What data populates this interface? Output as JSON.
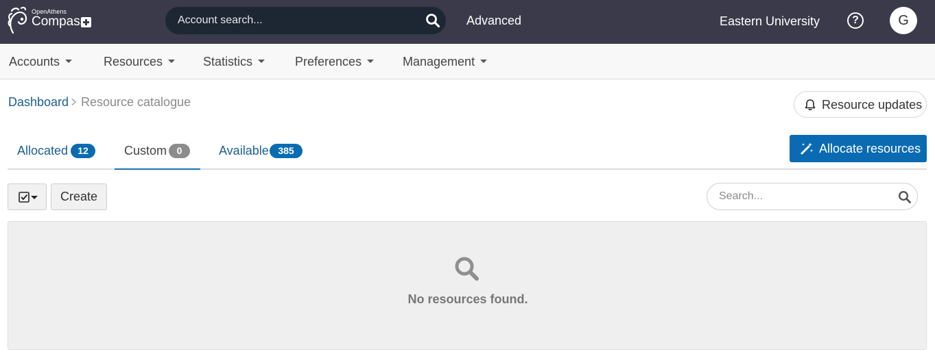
{
  "brand": {
    "small": "OpenAthens",
    "name": "Compass"
  },
  "header": {
    "search_placeholder": "Account search...",
    "advanced_label": "Advanced",
    "organisation": "Eastern University",
    "help_label": "?",
    "avatar_initial": "G"
  },
  "nav": {
    "items": [
      {
        "label": "Accounts"
      },
      {
        "label": "Resources"
      },
      {
        "label": "Statistics"
      },
      {
        "label": "Preferences"
      },
      {
        "label": "Management"
      }
    ]
  },
  "breadcrumb": {
    "root": "Dashboard",
    "current": "Resource catalogue"
  },
  "actions": {
    "updates_label": "Resource updates",
    "allocate_label": "Allocate resources"
  },
  "tabs": [
    {
      "label": "Allocated",
      "count": "12",
      "active": false,
      "badge_color": "#0a6bb3",
      "text_color": "#1a5f91"
    },
    {
      "label": "Custom",
      "count": "0",
      "active": true,
      "badge_color": "#8c8c8c",
      "text_color": "#444444"
    },
    {
      "label": "Available",
      "count": "385",
      "active": false,
      "badge_color": "#0a6bb3",
      "text_color": "#1a5f91"
    }
  ],
  "toolbar": {
    "create_label": "Create",
    "filter_placeholder": "Search..."
  },
  "empty_state": {
    "message": "No resources found."
  },
  "colors": {
    "topbar": "#3a3a4a",
    "accent": "#0a6bb3",
    "link": "#1a5f91"
  }
}
